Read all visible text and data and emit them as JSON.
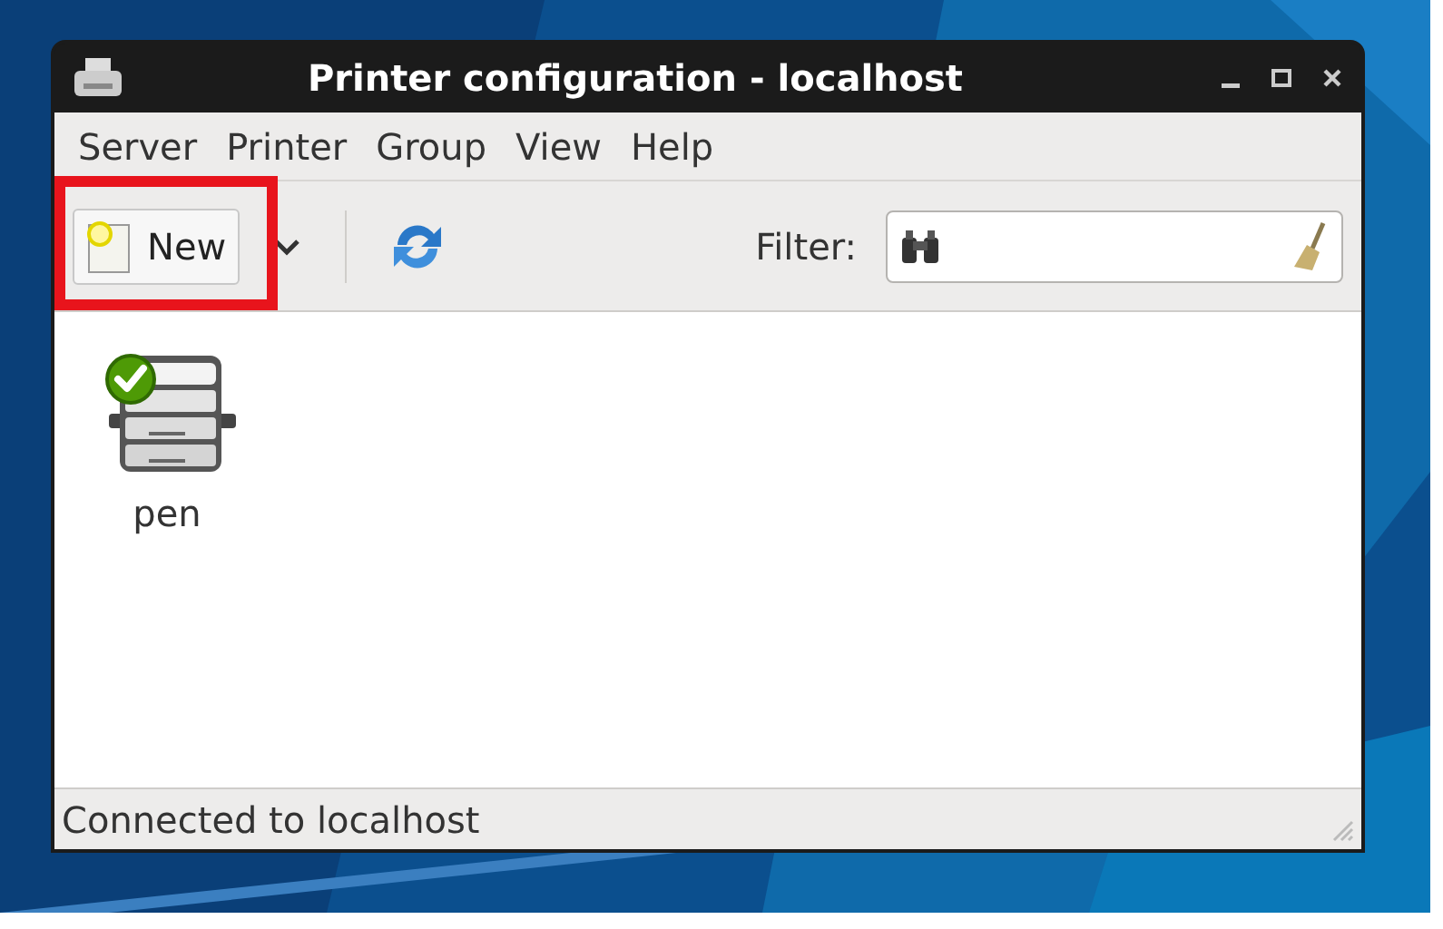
{
  "window": {
    "title": "Printer configuration - localhost"
  },
  "menu": [
    "Server",
    "Printer",
    "Group",
    "View",
    "Help"
  ],
  "toolbar": {
    "new_button": "New",
    "filter_label": "Filter:"
  },
  "printers": [
    {
      "name": "pen"
    }
  ],
  "status_bar": "Connected to localhost"
}
